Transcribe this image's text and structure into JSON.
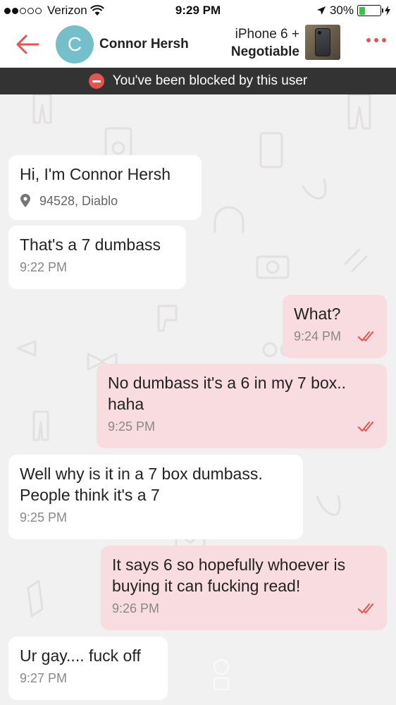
{
  "status_bar": {
    "carrier": "Verizon",
    "time": "9:29 PM",
    "battery": "30%",
    "battery_level": 0.3
  },
  "header": {
    "contact_initial": "C",
    "contact_name": "Connor Hersh",
    "item_title": "iPhone 6 +",
    "item_price": "Negotiable",
    "back_icon": "arrow-left-icon",
    "more_icon": "more-dots-icon",
    "accent_color": "#e8534f"
  },
  "banner": {
    "text": "You've been blocked by this user"
  },
  "messages": [
    {
      "dir": "in",
      "text": "Hi, I'm Connor Hersh",
      "location": "94528, Diablo"
    },
    {
      "dir": "in",
      "text": "That's a 7 dumbass",
      "time": "9:22 PM"
    },
    {
      "dir": "out",
      "text": "What?",
      "time": "9:24 PM"
    },
    {
      "dir": "out",
      "text": "No dumbass it's a 6 in my 7 box.. haha",
      "time": "9:25 PM"
    },
    {
      "dir": "in",
      "text": "Well why is it in a 7 box dumbass. People think it's a 7",
      "time": "9:25 PM"
    },
    {
      "dir": "out",
      "text": "It says 6 so hopefully whoever is buying it can fucking read!",
      "time": "9:26 PM"
    },
    {
      "dir": "in",
      "text": "Ur gay.... fuck off",
      "time": "9:27 PM"
    }
  ]
}
